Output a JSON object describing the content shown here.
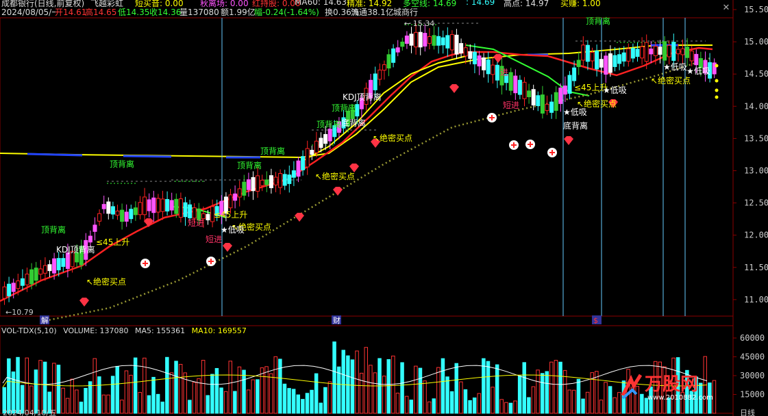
{
  "header": {
    "title": "成都银行(日线,前复权)",
    "indicator": "飞越彩虹",
    "short_buy": "短买音: 0.00",
    "autumn_sell": "秋离场: 0.00",
    "red_hold": "红持股: 0.00",
    "ma60": "MA60: 14.63",
    "cost_line": "精准: 14.92",
    "bull_line": "多空线: 14.69",
    "bull_value": ": 14.69",
    "high_point": "高点: 14.97",
    "buy_point": "买赚: 1.00"
  },
  "info_bar": {
    "date": "2024/08/05/一",
    "open": "开14.61",
    "high": "高14.65",
    "low": "低14.35",
    "close": "收14.36",
    "volume": "量137080",
    "amount": "额1.99亿",
    "change": "幅-0.24(-1.64%)",
    "turnover": "换0.36%",
    "float": "流通38.1亿",
    "sector": "城商行"
  },
  "price_axis": [
    "15.50",
    "15.00",
    "14.50",
    "14.00",
    "13.50",
    "13.00",
    "12.50",
    "12.00",
    "11.50",
    "11.00"
  ],
  "volume_axis": [
    "60000",
    "45000",
    "30000",
    "15000"
  ],
  "markers": {
    "high_mark": "15.34",
    "low_mark": "10.79",
    "bottom_left": "解",
    "bottom_mid": "财",
    "bottom_right": "$",
    "period": "日线"
  },
  "annotations": [
    {
      "text": "顶背离",
      "color": "#33ff33"
    },
    {
      "text": "顶背离",
      "color": "#33ff33"
    },
    {
      "text": "顶背离",
      "color": "#33ff33"
    },
    {
      "text": "顶背离",
      "color": "#33ff33"
    },
    {
      "text": "顶背离",
      "color": "#33ff33"
    },
    {
      "text": "顶背离",
      "color": "#33ff33"
    },
    {
      "text": "顶背离",
      "color": "#33ff33"
    },
    {
      "text": "KDJ顶背离",
      "color": "#ffffff"
    },
    {
      "text": "KDJ顶背离",
      "color": "#ffffff"
    },
    {
      "text": "底背离",
      "color": "#ffffff"
    },
    {
      "text": "底背离",
      "color": "#ffffff"
    },
    {
      "text": "≤45上升",
      "color": "#ffff00"
    },
    {
      "text": "≤45上升",
      "color": "#ffff00"
    },
    {
      "text": "≤45上升",
      "color": "#ffff00"
    },
    {
      "text": "↖绝密买点",
      "color": "#ffff00"
    },
    {
      "text": "↖绝密买点",
      "color": "#ffff00"
    },
    {
      "text": "↖绝密买点",
      "color": "#ffff00"
    },
    {
      "text": "↖绝密买点",
      "color": "#ffff00"
    },
    {
      "text": "↖绝密买点",
      "color": "#ffff00"
    },
    {
      "text": "↖绝密买点",
      "color": "#ffff00"
    },
    {
      "text": "★低吸",
      "color": "#ffffff"
    },
    {
      "text": "★低吸",
      "color": "#ffffff"
    },
    {
      "text": "★低吸",
      "color": "#ffffff"
    },
    {
      "text": "★低吸",
      "color": "#ffffff"
    },
    {
      "text": "★低吸",
      "color": "#ffffff"
    },
    {
      "text": "短进",
      "color": "#ff3366"
    },
    {
      "text": "短进",
      "color": "#ff3366"
    },
    {
      "text": "短进",
      "color": "#ff3366"
    },
    {
      "text": "进",
      "color": "#ff3366"
    }
  ],
  "volume_header": {
    "name": "VOL-TDX(5,10)",
    "volume": "VOLUME: 137080",
    "ma5": "MA5: 155361",
    "ma10": "MA10: 169557"
  },
  "watermark_logo": {
    "text": "万股网",
    "url": "www.2010882.com"
  },
  "bottom_date": "2024/04/10/五",
  "colors": {
    "up": "#ff3333",
    "down": "#33ffff",
    "yellow": "#ffff00",
    "green": "#33ff33",
    "magenta": "#ff55ff"
  },
  "icons": [
    "close-icon",
    "diamond-icon",
    "plus-circle-icon"
  ]
}
